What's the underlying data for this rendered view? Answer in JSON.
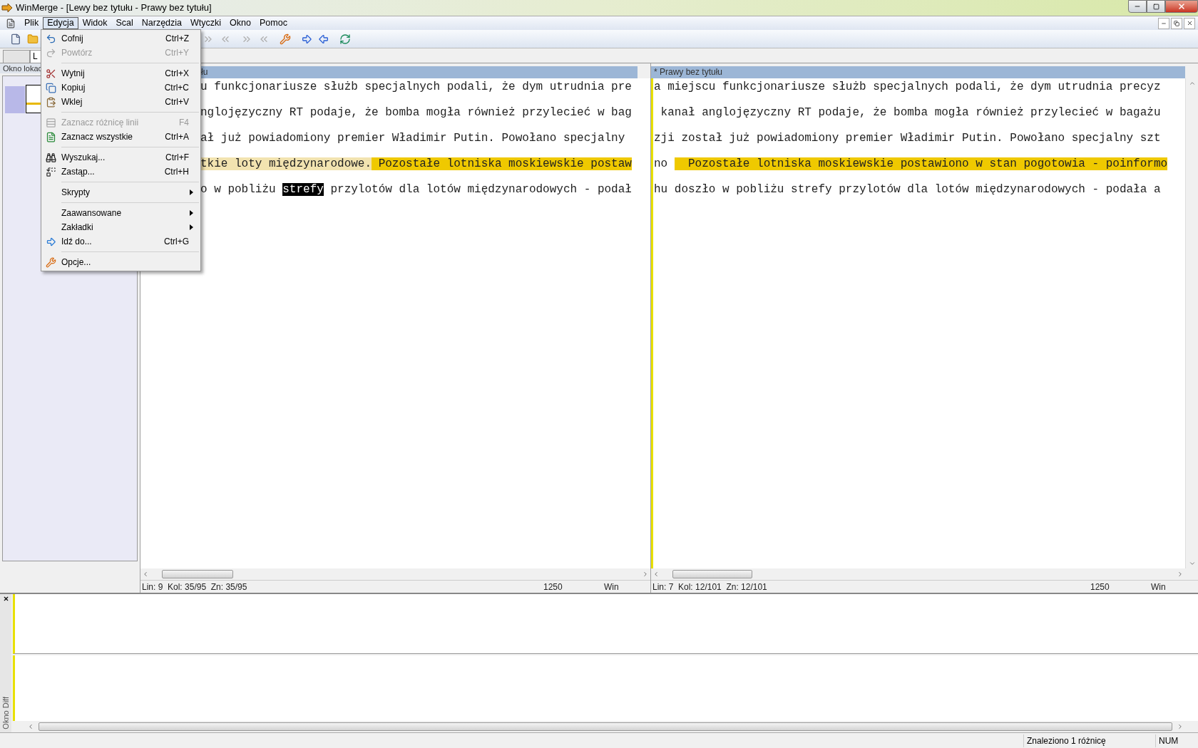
{
  "window": {
    "title": "WinMerge - [Lewy bez tytułu - Prawy bez tytułu]"
  },
  "menu_bar": {
    "items": [
      {
        "label": "Plik",
        "selected": false
      },
      {
        "label": "Edycja",
        "selected": true
      },
      {
        "label": "Widok",
        "selected": false
      },
      {
        "label": "Scal",
        "selected": false
      },
      {
        "label": "Narzędzia",
        "selected": false
      },
      {
        "label": "Wtyczki",
        "selected": false
      },
      {
        "label": "Okno",
        "selected": false
      },
      {
        "label": "Pomoc",
        "selected": false
      }
    ]
  },
  "edit_menu": {
    "items": [
      {
        "kind": "item",
        "label": "Cofnij",
        "shortcut": "Ctrl+Z",
        "disabled": false
      },
      {
        "kind": "item",
        "label": "Powtórz",
        "shortcut": "Ctrl+Y",
        "disabled": true
      },
      {
        "kind": "separator"
      },
      {
        "kind": "item",
        "label": "Wytnij",
        "shortcut": "Ctrl+X",
        "disabled": false
      },
      {
        "kind": "item",
        "label": "Kopiuj",
        "shortcut": "Ctrl+C",
        "disabled": false
      },
      {
        "kind": "item",
        "label": "Wklej",
        "shortcut": "Ctrl+V",
        "disabled": false
      },
      {
        "kind": "separator"
      },
      {
        "kind": "item",
        "label": "Zaznacz różnicę linii",
        "shortcut": "F4",
        "disabled": true
      },
      {
        "kind": "item",
        "label": "Zaznacz wszystkie",
        "shortcut": "Ctrl+A",
        "disabled": false
      },
      {
        "kind": "separator"
      },
      {
        "kind": "item",
        "label": "Wyszukaj...",
        "shortcut": "Ctrl+F",
        "disabled": false
      },
      {
        "kind": "item",
        "label": "Zastąp...",
        "shortcut": "Ctrl+H",
        "disabled": false
      },
      {
        "kind": "separator"
      },
      {
        "kind": "submenu",
        "label": "Skrypty"
      },
      {
        "kind": "separator"
      },
      {
        "kind": "submenu",
        "label": "Zaawansowane"
      },
      {
        "kind": "submenu",
        "label": "Zakładki"
      },
      {
        "kind": "item",
        "label": "Idź do...",
        "shortcut": "Ctrl+G",
        "disabled": false
      },
      {
        "kind": "separator"
      },
      {
        "kind": "item",
        "label": "Opcje...",
        "disabled": false
      }
    ]
  },
  "tabs": [
    {
      "selected": false
    },
    {
      "label": "L",
      "selected": true
    }
  ],
  "location_pane": {
    "title": "Okno lokac"
  },
  "left_editor": {
    "title": "łu",
    "lines": [
      [
        {
          "kind": "normal",
          "text": "u funkcjonariusze służb specjalnych podali, że dym utrudnia pre"
        }
      ],
      [
        {
          "kind": "normal",
          "text": "nglojęzyczny RT podaje, że bomba mogła również przylecieć w bag"
        }
      ],
      [
        {
          "kind": "normal",
          "text": "ał już powiadomiony premier Władimir Putin. Powołano specjalny"
        }
      ],
      [
        {
          "kind": "diff",
          "text": "tkie loty międzynarodowe."
        },
        {
          "kind": "change",
          "text": " Pozostałe lotniska moskiewskie postaw"
        }
      ],
      [
        {
          "kind": "normal",
          "text": "o w pobliżu "
        },
        {
          "kind": "selected",
          "text": "strefy"
        },
        {
          "kind": "normal",
          "text": " przylotów dla lotów międzynarodowych - podał"
        }
      ]
    ],
    "status": {
      "position": "Lin: 9  Kol: 35/95  Zn: 35/95",
      "codepage": "1250",
      "eol": "Win"
    }
  },
  "right_editor": {
    "title": "* Prawy bez tytułu",
    "lines": [
      [
        {
          "kind": "normal",
          "text": "a miejscu funkcjonariusze służb specjalnych podali, że dym utrudnia precyz"
        }
      ],
      [
        {
          "kind": "normal",
          "text": " kanał anglojęzyczny RT podaje, że bomba mogła również przylecieć w bagażu"
        }
      ],
      [
        {
          "kind": "normal",
          "text": "zji został już powiadomiony premier Władimir Putin. Powołano specjalny szt"
        }
      ],
      [
        {
          "kind": "normal",
          "text": "no "
        },
        {
          "kind": "change",
          "text": "  Pozostałe lotniska moskiewskie postawiono w stan pogotowia - poinformo"
        }
      ],
      [
        {
          "kind": "normal",
          "text": "hu doszło w pobliżu strefy przylotów dla lotów międzynarodowych - podała a"
        }
      ]
    ],
    "status": {
      "position": "Lin: 7  Kol: 12/101  Zn: 12/101",
      "codepage": "1250",
      "eol": "Win"
    }
  },
  "diff_pane": {
    "title": "Okno Diff"
  },
  "status_bar": {
    "message": "Znaleziono 1 różnicę",
    "indicator": "NUM"
  }
}
